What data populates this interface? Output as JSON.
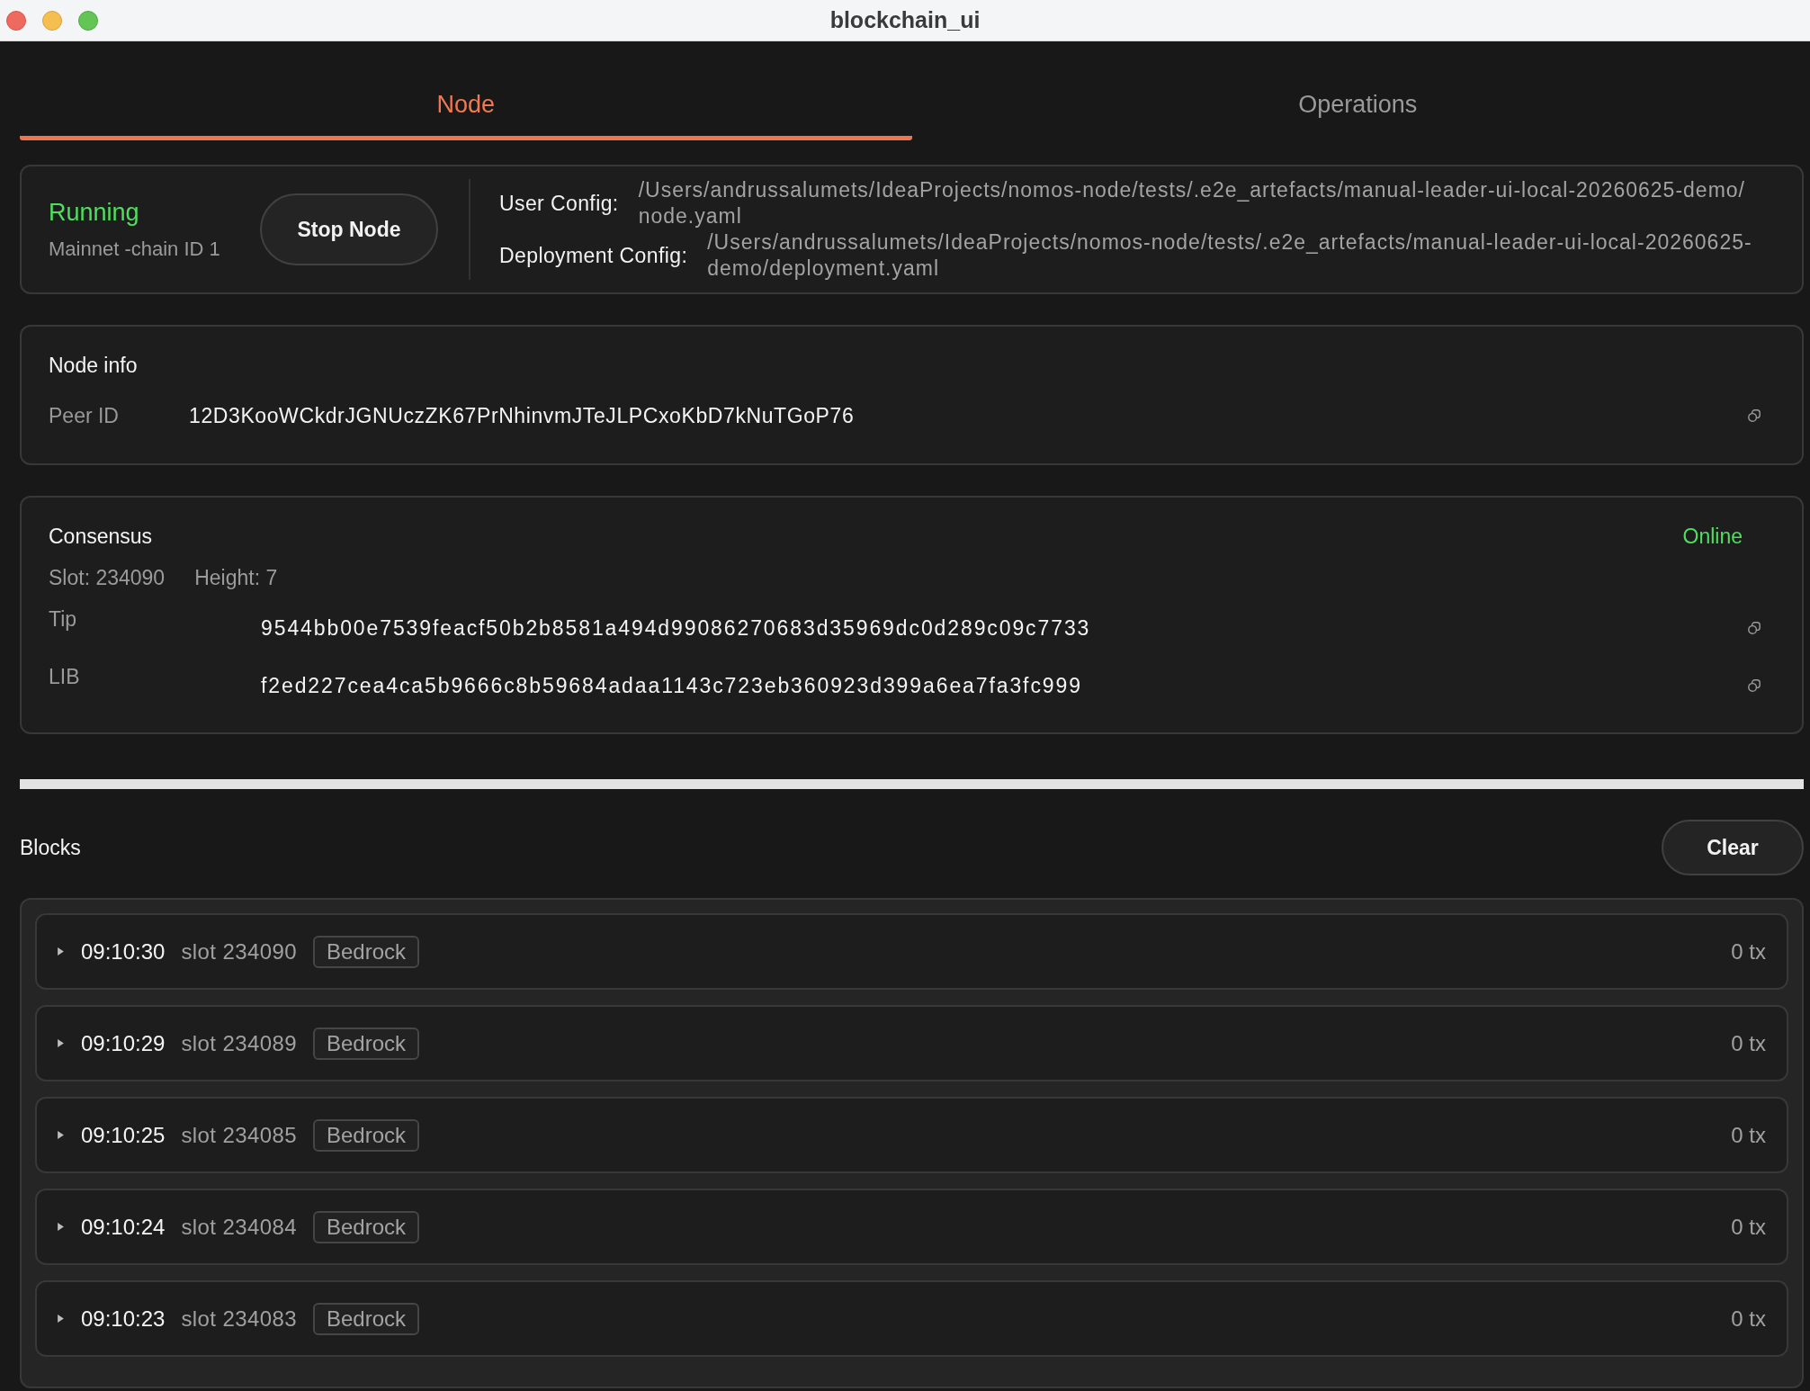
{
  "window": {
    "title": "blockchain_ui"
  },
  "tabs": [
    {
      "label": "Node",
      "selected": true
    },
    {
      "label": "Operations",
      "selected": false
    }
  ],
  "node_status": {
    "state": "Running",
    "running": true,
    "network": "Mainnet -chain ID 1",
    "stop_button": "Stop Node",
    "configs": [
      {
        "label": "User Config:",
        "path": "/Users/andrussalumets/IdeaProjects/nomos-node/tests/.e2e_artefacts/manual-leader-ui-local-20260625-demo/node.yaml"
      },
      {
        "label": "Deployment Config:",
        "path": "/Users/andrussalumets/IdeaProjects/nomos-node/tests/.e2e_artefacts/manual-leader-ui-local-20260625-demo/deployment.yaml"
      }
    ]
  },
  "node_info": {
    "title": "Node info",
    "fields": [
      {
        "label": "Peer ID",
        "value": "12D3KooWCkdrJGNUczZK67PrNhinvmJTeJLPCxoKbD7kNuTGoP76"
      }
    ]
  },
  "consensus": {
    "title": "Consensus",
    "status": "Online",
    "online": true,
    "slot": "Slot: 234090",
    "height": "Height: 7",
    "hashes": [
      {
        "label": "Tip",
        "value": "9544bb00e7539feacf50b2b8581a494d99086270683d35969dc0d289c09c7733"
      },
      {
        "label": "LIB",
        "value": "f2ed227cea4ca5b9666c8b59684adaa1143c723eb360923d399a6ea7fa3fc999"
      }
    ]
  },
  "blocks": {
    "title": "Blocks",
    "clear_button": "Clear",
    "rows": [
      {
        "expanded": false,
        "time": "09:10:30",
        "slot": "slot 234090",
        "tag": "Bedrock",
        "tx": "0 tx"
      },
      {
        "expanded": false,
        "time": "09:10:29",
        "slot": "slot 234089",
        "tag": "Bedrock",
        "tx": "0 tx"
      },
      {
        "expanded": false,
        "time": "09:10:25",
        "slot": "slot 234085",
        "tag": "Bedrock",
        "tx": "0 tx"
      },
      {
        "expanded": false,
        "time": "09:10:24",
        "slot": "slot 234084",
        "tag": "Bedrock",
        "tx": "0 tx"
      },
      {
        "expanded": false,
        "time": "09:10:23",
        "slot": "slot 234083",
        "tag": "Bedrock",
        "tx": "0 tx"
      }
    ]
  }
}
